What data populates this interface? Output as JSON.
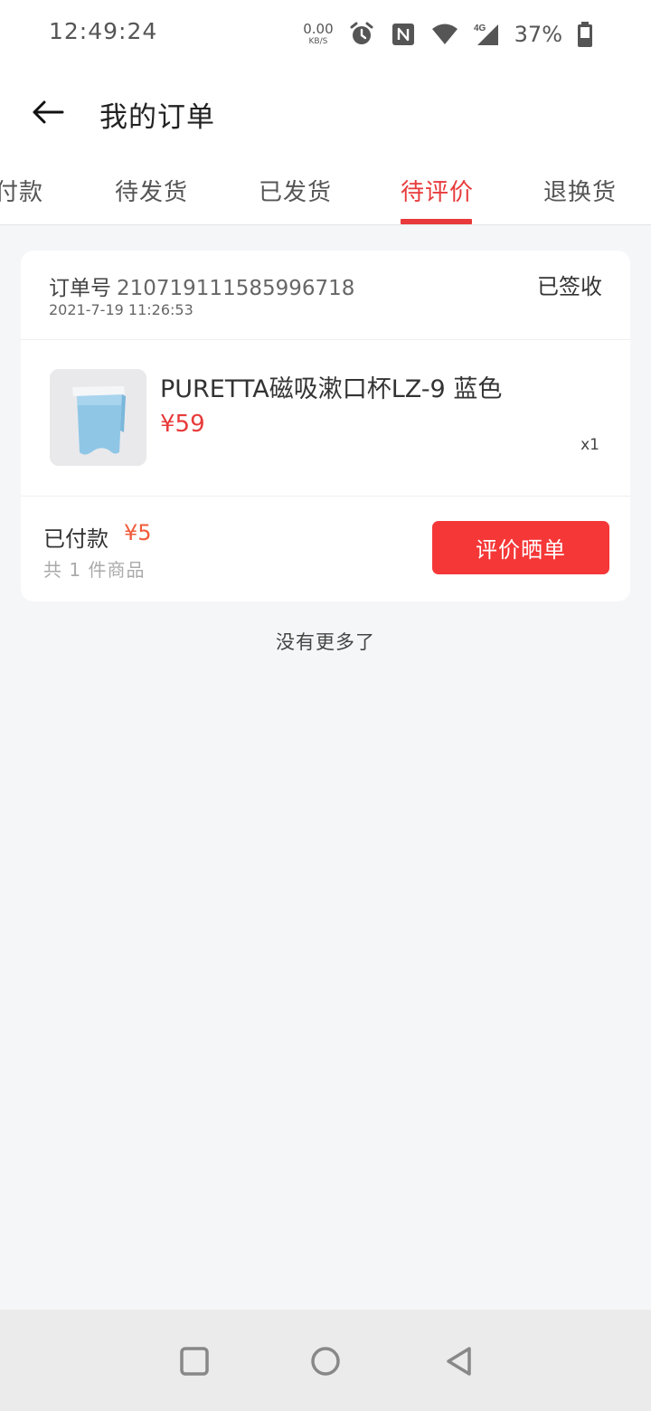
{
  "status_bar": {
    "time": "12:49:24",
    "net_speed_value": "0.00",
    "net_speed_unit": "KB/S",
    "battery_percent": "37%",
    "icons": [
      "alarm-icon",
      "nfc-icon",
      "wifi-icon",
      "signal-4g-icon",
      "battery-icon"
    ]
  },
  "header": {
    "title": "我的订单",
    "back_icon": "arrow-left-icon"
  },
  "tabs": [
    {
      "label": "付款",
      "active": false
    },
    {
      "label": "待发货",
      "active": false
    },
    {
      "label": "已发货",
      "active": false
    },
    {
      "label": "待评价",
      "active": true
    },
    {
      "label": "退换货",
      "active": false
    }
  ],
  "order": {
    "number_label": "订单号",
    "number": "2107191115859967​18",
    "date": "2021-7-19 11:26:53",
    "status": "已签收",
    "product": {
      "name": "PURETTA磁吸漱口杯LZ-9 蓝色",
      "price": "¥59",
      "quantity": "x1"
    },
    "paid_label": "已付款",
    "paid_amount": "¥5",
    "item_count": "共 1 件商品",
    "review_button": "评价晒单"
  },
  "footer_text": "没有更多了",
  "colors": {
    "accent": "#e83a3a",
    "button": "#f53737",
    "background": "#f5f6f8"
  },
  "nav": [
    "square-icon",
    "circle-icon",
    "triangle-back-icon"
  ]
}
